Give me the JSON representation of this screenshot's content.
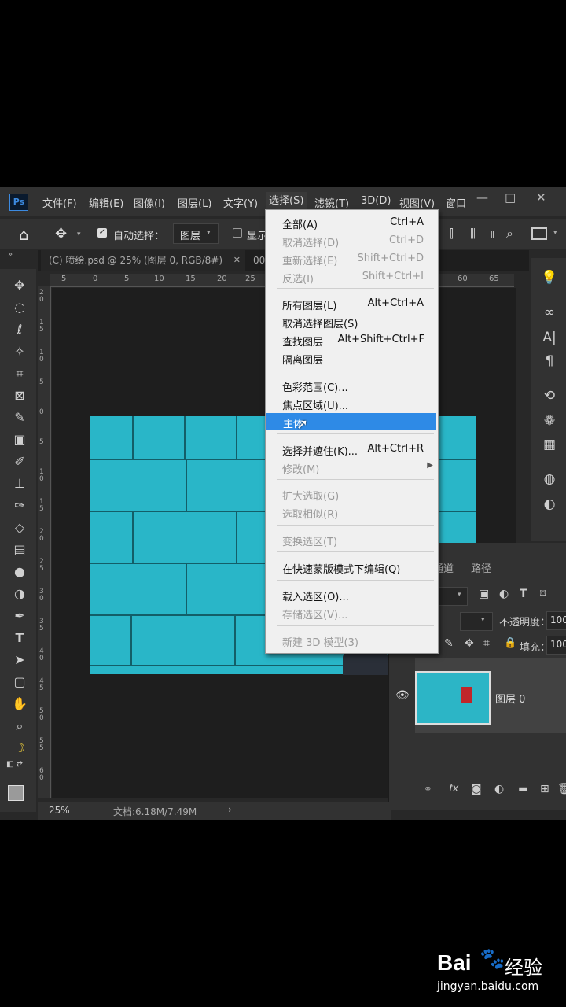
{
  "app": {
    "logo": "Ps"
  },
  "menubar": {
    "items": [
      "文件(F)",
      "编辑(E)",
      "图像(I)",
      "图层(L)",
      "文字(Y)",
      "选择(S)",
      "滤镜(T)",
      "3D(D)",
      "视图(V)",
      "窗口"
    ],
    "active": "选择(S)",
    "window_controls": [
      "—",
      "□",
      "✕"
    ]
  },
  "options_bar": {
    "auto_select_label": "自动选择：",
    "auto_select_checked": true,
    "target_value": "图层",
    "show_label": "显示"
  },
  "tabs": [
    {
      "label": "(C) 喷绘.psd @ 25% (图层 0, RGB/8#)",
      "close": "✕"
    },
    {
      "label": "00"
    }
  ],
  "ruler": {
    "h_ticks": [
      "5",
      "0",
      "5",
      "10",
      "15",
      "20",
      "25",
      "60",
      "65"
    ],
    "v_ticks": [
      "2\n0",
      "1\n5",
      "1\n0",
      "5",
      "0",
      "5",
      "1\n0",
      "1\n5",
      "2\n0",
      "2\n5",
      "3\n0",
      "3\n5",
      "4\n0",
      "4\n5",
      "5\n0",
      "5\n5",
      "6\n0"
    ]
  },
  "select_menu": {
    "items": [
      {
        "label": "全部(A)",
        "shortcut": "Ctrl+A",
        "disabled": false
      },
      {
        "label": "取消选择(D)",
        "shortcut": "Ctrl+D",
        "disabled": true
      },
      {
        "label": "重新选择(E)",
        "shortcut": "Shift+Ctrl+D",
        "disabled": true
      },
      {
        "label": "反选(I)",
        "shortcut": "Shift+Ctrl+I",
        "disabled": true
      },
      {
        "label": "所有图层(L)",
        "shortcut": "Alt+Ctrl+A",
        "disabled": false
      },
      {
        "label": "取消选择图层(S)",
        "shortcut": "",
        "disabled": false
      },
      {
        "label": "查找图层",
        "shortcut": "Alt+Shift+Ctrl+F",
        "disabled": false
      },
      {
        "label": "隔离图层",
        "shortcut": "",
        "disabled": false
      },
      {
        "label": "色彩范围(C)...",
        "shortcut": "",
        "disabled": false
      },
      {
        "label": "焦点区域(U)...",
        "shortcut": "",
        "disabled": false
      },
      {
        "label": "主体",
        "shortcut": "",
        "disabled": false,
        "highlighted": true
      },
      {
        "label": "选择并遮住(K)...",
        "shortcut": "Alt+Ctrl+R",
        "disabled": false
      },
      {
        "label": "修改(M)",
        "shortcut": "",
        "disabled": true,
        "submenu": true
      },
      {
        "label": "扩大选取(G)",
        "shortcut": "",
        "disabled": true
      },
      {
        "label": "选取相似(R)",
        "shortcut": "",
        "disabled": true
      },
      {
        "label": "变换选区(T)",
        "shortcut": "",
        "disabled": true
      },
      {
        "label": "在快速蒙版模式下编辑(Q)",
        "shortcut": "",
        "disabled": false
      },
      {
        "label": "载入选区(O)...",
        "shortcut": "",
        "disabled": false
      },
      {
        "label": "存储选区(V)...",
        "shortcut": "",
        "disabled": true
      },
      {
        "label": "新建 3D 模型(3)",
        "shortcut": "",
        "disabled": true
      }
    ]
  },
  "layers_panel": {
    "tabs": [
      "通道",
      "路径"
    ],
    "opacity_label": "不透明度：",
    "opacity_value": "100",
    "fill_label": "填充：",
    "fill_value": "100",
    "layer_name": "图层 0"
  },
  "status": {
    "zoom": "25%",
    "doc_info": "文档:6.18M/7.49M",
    "arrow": "›"
  },
  "watermark": {
    "brand": "Bai",
    "brand2": "经验",
    "url": "jingyan.baidu.com"
  }
}
